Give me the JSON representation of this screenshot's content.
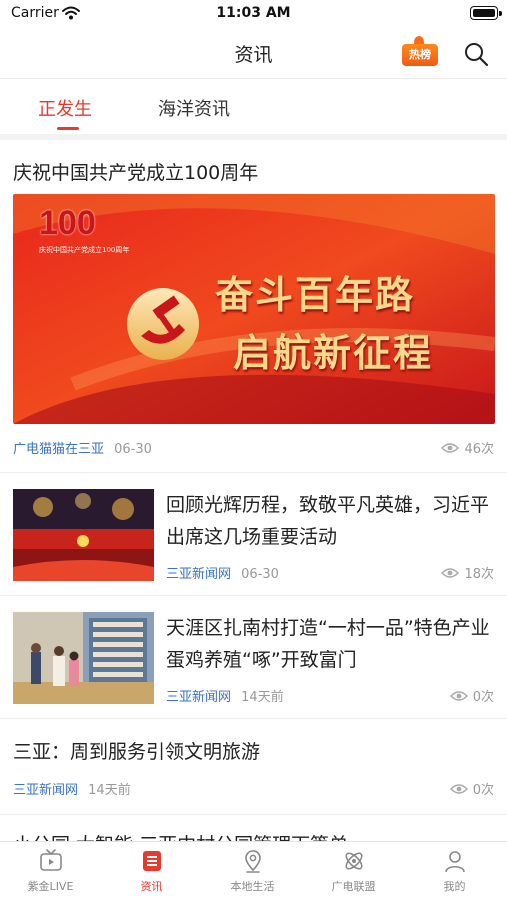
{
  "status_bar": {
    "carrier": "Carrier",
    "time": "11:03 AM"
  },
  "nav": {
    "title": "资讯",
    "hot_badge": "热榜"
  },
  "tabs": [
    {
      "label": "正发生",
      "active": true
    },
    {
      "label": "海洋资讯",
      "active": false
    }
  ],
  "feed": {
    "featured": {
      "title": "庆祝中国共产党成立100周年",
      "banner": {
        "line1": "奋斗百年路",
        "line2": "启航新征程",
        "logo_number": "100",
        "logo_caption": "庆祝中国共产党成立100周年"
      },
      "source": "广电猫猫在三亚",
      "date": "06-30",
      "views": "46次"
    },
    "articles": [
      {
        "title": "回顾光辉历程，致敬平凡英雄，习近平出席这几场重要活动",
        "source": "三亚新闻网",
        "date": "06-30",
        "views": "18次"
      },
      {
        "title": "天涯区扎南村打造“一村一品”特色产业 蛋鸡养殖“啄”开致富门",
        "source": "三亚新闻网",
        "date": "14天前",
        "views": "0次"
      }
    ],
    "text_article": {
      "title": "三亚：周到服务引领文明旅游",
      "source": "三亚新闻网",
      "date": "14天前",
      "views": "0次"
    },
    "partial_title": "小公园 大智能 三亚中村公园管理下篇单"
  },
  "tab_bar": [
    {
      "label": "紫金LIVE",
      "icon": "tv-icon",
      "active": false
    },
    {
      "label": "资讯",
      "icon": "news-icon",
      "active": true
    },
    {
      "label": "本地生活",
      "icon": "location-icon",
      "active": false
    },
    {
      "label": "广电联盟",
      "icon": "atom-icon",
      "active": false
    },
    {
      "label": "我的",
      "icon": "user-icon",
      "active": false
    }
  ],
  "colors": {
    "accent": "#e53a2c",
    "source_link": "#3a73c4",
    "banner_gold": "#f7d98a"
  }
}
